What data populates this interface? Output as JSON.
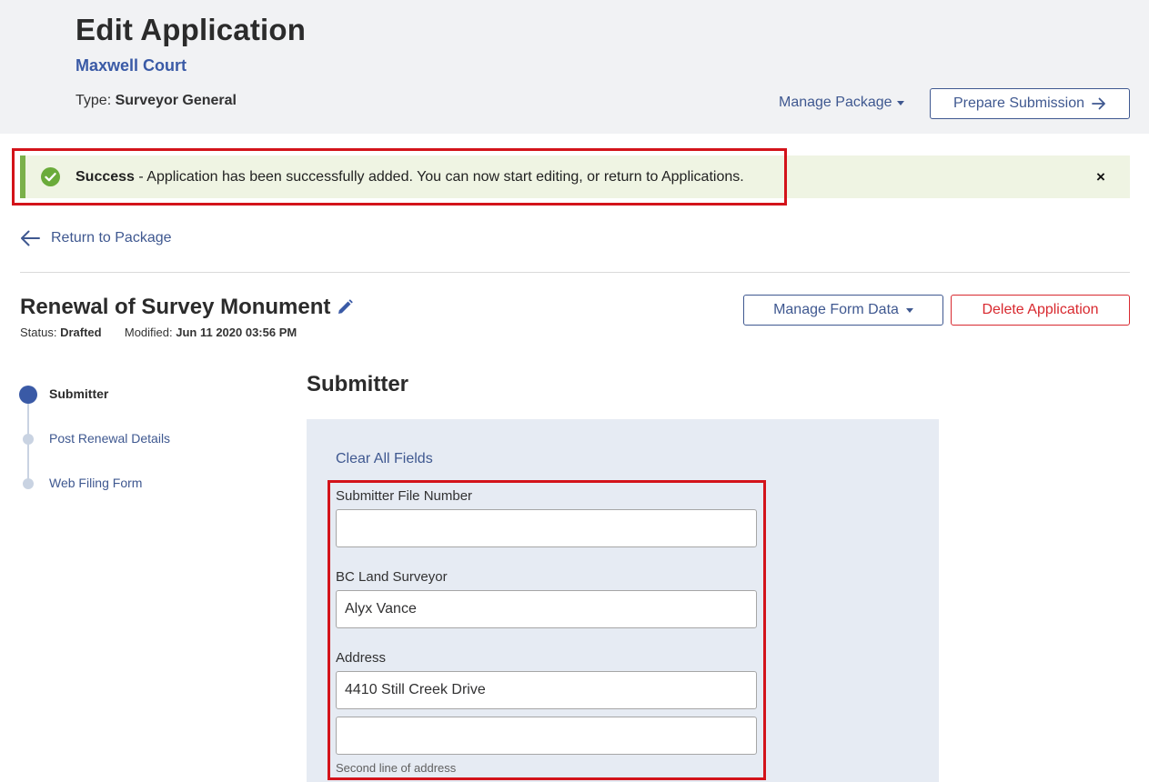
{
  "header": {
    "title": "Edit Application",
    "subtitle": "Maxwell Court",
    "type_label": "Type:",
    "type_value": "Surveyor General",
    "manage_package_label": "Manage Package",
    "prepare_submission_label": "Prepare Submission"
  },
  "alert": {
    "strong": "Success",
    "message": " - Application has been successfully added. You can now start editing, or return to Applications.",
    "close_glyph": "×",
    "color": "#7ab04a"
  },
  "nav": {
    "return_label": "Return to Package"
  },
  "application": {
    "title": "Renewal of Survey Monument",
    "status_label": "Status:",
    "status_value": "Drafted",
    "modified_label": "Modified:",
    "modified_value": "Jun 11 2020 03:56 PM",
    "manage_form_data_label": "Manage Form Data",
    "delete_label": "Delete Application"
  },
  "steps": [
    {
      "label": "Submitter",
      "active": true
    },
    {
      "label": "Post Renewal Details",
      "active": false
    },
    {
      "label": "Web Filing Form",
      "active": false
    }
  ],
  "form": {
    "section_title": "Submitter",
    "clear_label": "Clear All Fields",
    "fields": {
      "file_number": {
        "label": "Submitter File Number",
        "value": ""
      },
      "surveyor": {
        "label": "BC Land Surveyor",
        "value": "Alyx Vance"
      },
      "address": {
        "label": "Address",
        "line1": "4410 Still Creek Drive",
        "line2": "",
        "help": "Second line of address"
      }
    }
  },
  "colors": {
    "accent": "#3f5890",
    "brand_blue": "#3a5aa6",
    "danger": "#d8292f",
    "highlight": "#d3131a"
  }
}
